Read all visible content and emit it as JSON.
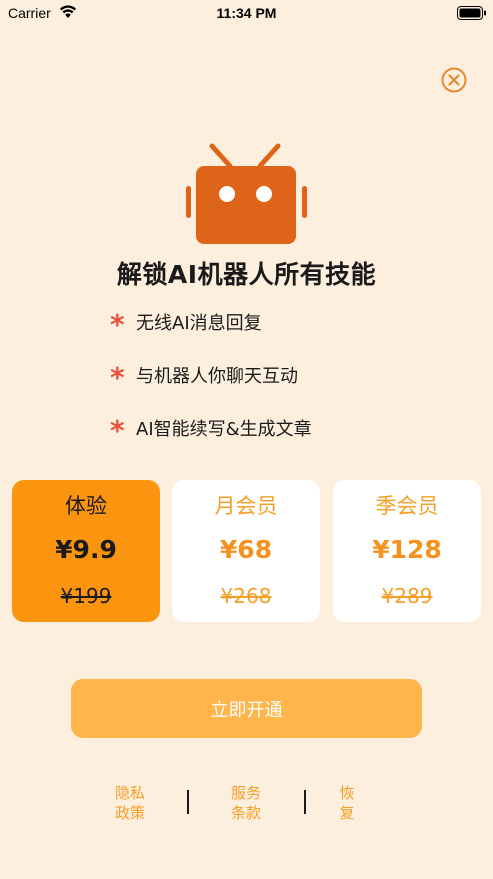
{
  "status_bar": {
    "carrier": "Carrier",
    "time": "11:34 PM"
  },
  "colors": {
    "background": "#fdefdd",
    "accent": "#fb9510",
    "accent_light": "#ffb54a",
    "star": "#e8503c",
    "robot": "#dd6418"
  },
  "headline": "解锁AI机器人所有技能",
  "features": [
    {
      "icon": "star-icon",
      "text": "无线AI消息回复"
    },
    {
      "icon": "star-icon",
      "text": "与机器人你聊天互动"
    },
    {
      "icon": "star-icon",
      "text": "AI智能续写&生成文章"
    }
  ],
  "plans": [
    {
      "name": "体验",
      "price": "¥9.9",
      "original_price": "¥199",
      "selected": true
    },
    {
      "name": "月会员",
      "price": "¥68",
      "original_price": "¥268",
      "selected": false
    },
    {
      "name": "季会员",
      "price": "¥128",
      "original_price": "¥289",
      "selected": false
    }
  ],
  "cta_label": "立即开通",
  "footer_links": [
    {
      "label": "隐私\n政策"
    },
    {
      "label": "服务\n条款"
    },
    {
      "label": "恢\n复"
    }
  ]
}
